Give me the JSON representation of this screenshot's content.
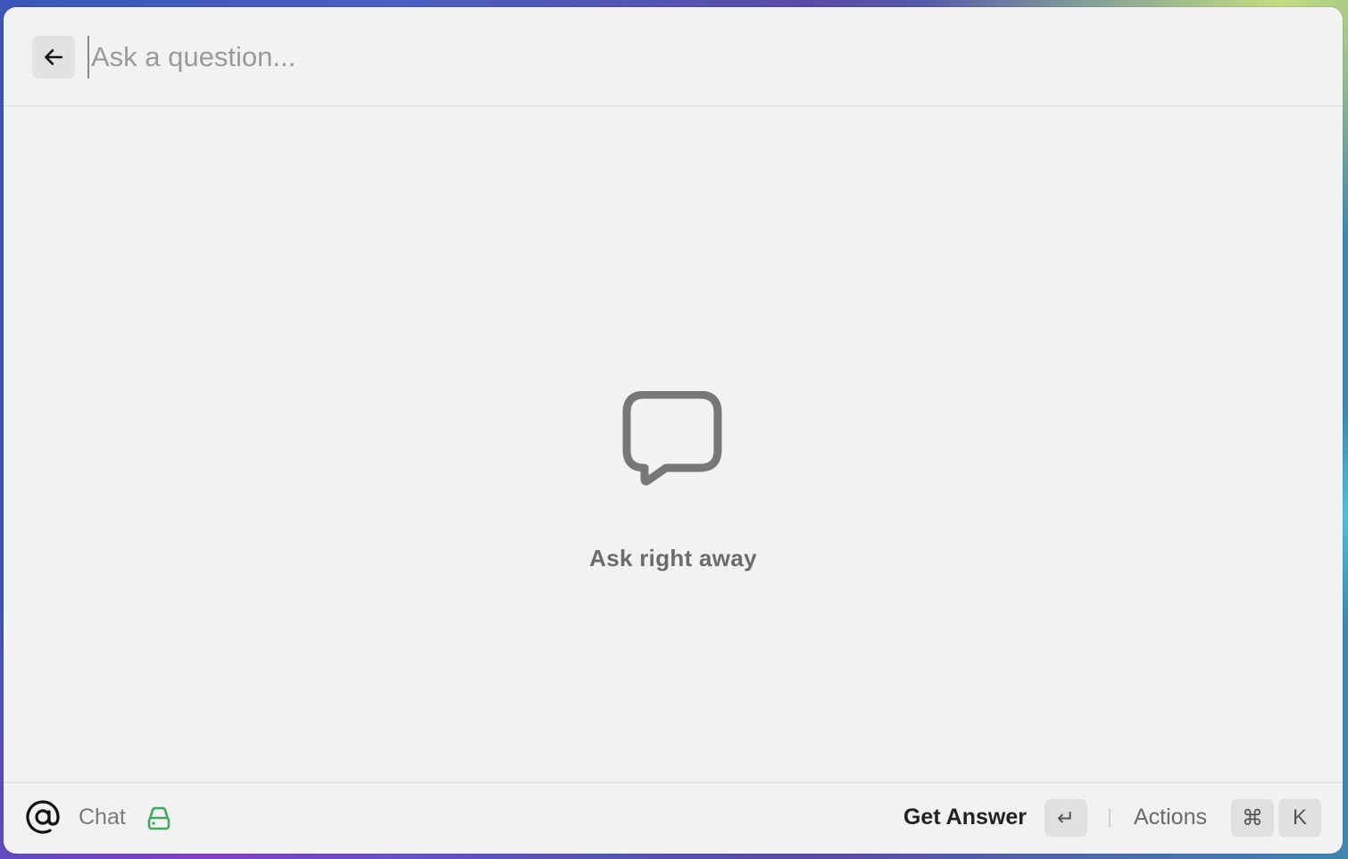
{
  "header": {
    "back_icon": "arrow-left-icon",
    "search_placeholder": "Ask a question...",
    "search_value": ""
  },
  "empty_state": {
    "icon": "chat-bubble-icon",
    "label": "Ask right away"
  },
  "footer": {
    "mention_icon": "at-icon",
    "mode_label": "Chat",
    "source_icon": "drive-icon",
    "primary_action_label": "Get Answer",
    "enter_key_glyph": "↵",
    "actions_label": "Actions",
    "cmd_key_glyph": "⌘",
    "k_key_glyph": "K"
  },
  "colors": {
    "window_bg": "#f2f2f2",
    "drive_icon": "#3daa5c",
    "icon_gray": "#777777"
  }
}
